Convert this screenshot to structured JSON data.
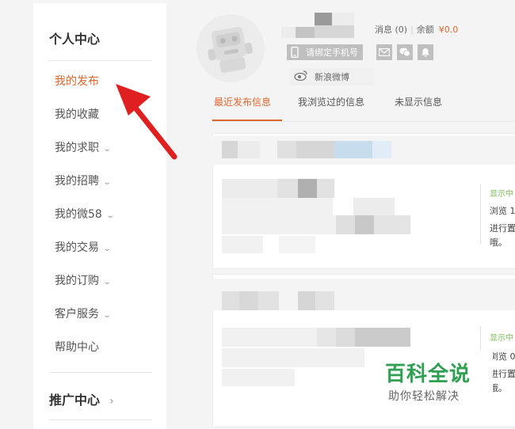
{
  "sidebar": {
    "title": "个人中心",
    "items": [
      {
        "label": "我的发布",
        "active": true,
        "chevron": false
      },
      {
        "label": "我的收藏",
        "active": false,
        "chevron": false
      },
      {
        "label": "我的求职",
        "active": false,
        "chevron": true
      },
      {
        "label": "我的招聘",
        "active": false,
        "chevron": true
      },
      {
        "label": "我的微58",
        "active": false,
        "chevron": true
      },
      {
        "label": "我的交易",
        "active": false,
        "chevron": true
      },
      {
        "label": "我的订购",
        "active": false,
        "chevron": true
      },
      {
        "label": "客户服务",
        "active": false,
        "chevron": true
      },
      {
        "label": "帮助中心",
        "active": false,
        "chevron": false
      }
    ],
    "promo": "推广中心",
    "chevron_glyph": "⌄",
    "promo_chevron": "›"
  },
  "profile": {
    "messages": "消息 (0)",
    "balance_label": "余额",
    "balance": "¥0.0",
    "bind_phone": "请绑定手机号",
    "weibo": "新浪微博"
  },
  "tabs": [
    "最近发布信息",
    "我浏览过的信息",
    "未显示信息"
  ],
  "listings": [
    {
      "status": "显示中",
      "line1": "浏览 1",
      "line2": "进行置",
      "line3": "哦。"
    },
    {
      "status": "显示中",
      "line1": "浏览 0",
      "line2": "进行置",
      "line3": "哦。"
    }
  ],
  "watermark": {
    "title": "百科全说",
    "subtitle": "助你轻松解决"
  },
  "colors": {
    "accent": "#e0662f",
    "status_green": "#7bbf58",
    "arrow_red": "#e02020",
    "watermark_green": "#2fa052"
  },
  "icons": [
    "phone-icon",
    "mail-icon",
    "wechat-icon",
    "bell-icon",
    "weibo-icon",
    "chevron-down-icon",
    "chevron-right-icon",
    "red-arrow"
  ]
}
